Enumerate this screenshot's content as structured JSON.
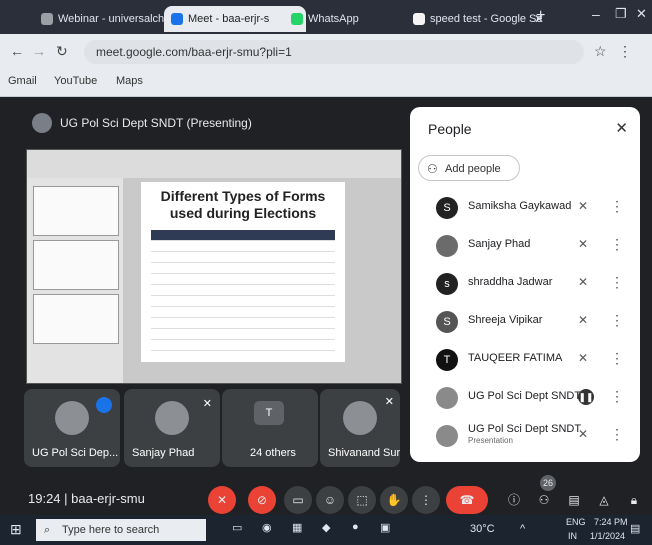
{
  "browser": {
    "tabs": [
      {
        "label": "Webinar - universalch",
        "active": false
      },
      {
        "label": "Meet - baa-erjr-s",
        "active": true
      },
      {
        "label": "WhatsApp",
        "active": false
      },
      {
        "label": "speed test - Google Se",
        "active": false
      }
    ],
    "url": "meet.google.com/baa-erjr-smu?pli=1",
    "bookmarks": [
      "Gmail",
      "YouTube",
      "Maps"
    ]
  },
  "meeting": {
    "presenter_label": "UG Pol Sci Dept SNDT (Presenting)",
    "slide": {
      "title": "Different Types of Forms used during Elections"
    },
    "tiles": [
      {
        "label": "UG Pol Sci Dep..."
      },
      {
        "label": "Sanjay Phad"
      },
      {
        "label": "24 others"
      },
      {
        "label": "Shivanand Sury..."
      }
    ],
    "code": "19:24 | baa-erjr-smu"
  },
  "people_panel": {
    "title": "People",
    "add_people": "Add people",
    "participants": [
      {
        "name": "Samiksha Gaykawad",
        "initial": "S",
        "sub": ""
      },
      {
        "name": "Sanjay Phad",
        "initial": "",
        "sub": ""
      },
      {
        "name": "shraddha Jadwar",
        "initial": "s",
        "sub": ""
      },
      {
        "name": "Shreeja Vipikar",
        "initial": "S",
        "sub": ""
      },
      {
        "name": "TAUQEER FATIMA",
        "initial": "T",
        "sub": ""
      },
      {
        "name": "UG Pol Sci Dept SNDT",
        "initial": "",
        "sub": ""
      },
      {
        "name": "UG Pol Sci Dept SNDT",
        "initial": "",
        "sub": "Presentation"
      }
    ]
  },
  "controls": {
    "badge": "26"
  },
  "taskbar": {
    "search_placeholder": "Type here to search",
    "weather": "30°C",
    "lang": "ENG",
    "lang2": "IN",
    "time": "7:24 PM",
    "date": "1/1/2024"
  }
}
